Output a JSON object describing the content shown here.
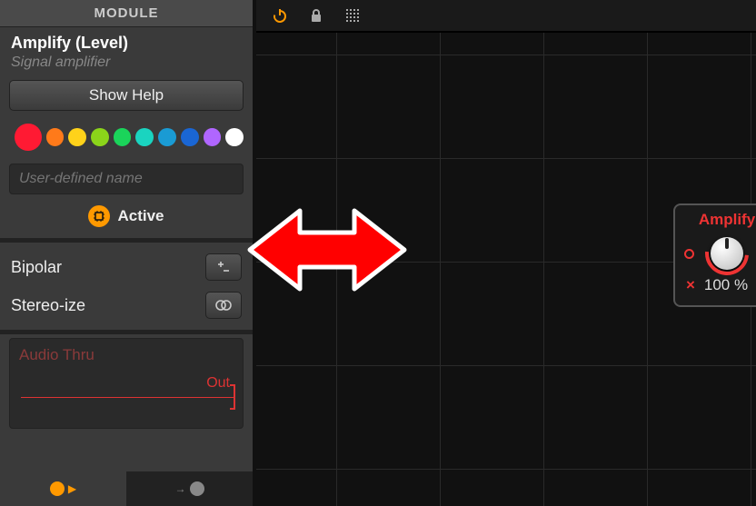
{
  "panel": {
    "header": "MODULE",
    "title": "Amplify (Level)",
    "subtitle": "Signal amplifier",
    "help_label": "Show Help",
    "name_placeholder": "User-defined name",
    "active_label": "Active",
    "params": {
      "bipolar": {
        "label": "Bipolar",
        "icon": "plus-minus"
      },
      "stereoize": {
        "label": "Stereo-ize",
        "icon": "stereo-circles"
      }
    },
    "audio_block": {
      "title": "Audio Thru",
      "out_label": "Out"
    },
    "tabs": {
      "knob_out": "knob-out",
      "arrow_knob": "arrow-knob"
    }
  },
  "colors": [
    {
      "hex": "#ff1a33",
      "selected": true
    },
    {
      "hex": "#ff7a1a",
      "selected": false
    },
    {
      "hex": "#ffd21a",
      "selected": false
    },
    {
      "hex": "#8bd41a",
      "selected": false
    },
    {
      "hex": "#1ad45a",
      "selected": false
    },
    {
      "hex": "#1ad4c0",
      "selected": false
    },
    {
      "hex": "#1a9bd4",
      "selected": false
    },
    {
      "hex": "#1a66d4",
      "selected": false
    },
    {
      "hex": "#b066ff",
      "selected": false
    },
    {
      "hex": "#ffffff",
      "selected": false
    }
  ],
  "canvas": {
    "toolbar": {
      "power": true,
      "lock": true,
      "grid": true
    },
    "node": {
      "title": "Amplify",
      "value": "100 %",
      "accent": "#e33333"
    }
  }
}
